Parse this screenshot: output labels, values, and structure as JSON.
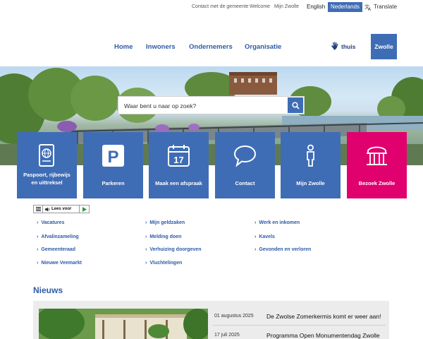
{
  "utility": {
    "contact": "Contact met de gemeente",
    "welcome": "Welcome",
    "mijn_zwolle": "Mijn Zwolle",
    "lang_english": "English",
    "lang_nederlands": "Nederlands",
    "translate": "Translate"
  },
  "nav": {
    "home": "Home",
    "inwoners": "Inwoners",
    "ondernemers": "Ondernemers",
    "organisatie": "Organisatie",
    "thuis": "thuis",
    "logo": "Zwolle"
  },
  "search": {
    "placeholder": "Waar bent u naar op zoek?"
  },
  "tiles": [
    {
      "line1": "Paspoort, rijbewijs",
      "line2": "en uittreksel",
      "icon": "passport-icon"
    },
    {
      "line1": "Parkeren",
      "icon": "parking-icon"
    },
    {
      "line1": "Maak een afspraak",
      "icon": "calendar-17-icon",
      "calendar_day": "17"
    },
    {
      "line1": "Contact",
      "icon": "speech-bubble-icon"
    },
    {
      "line1": "Mijn Zwolle",
      "icon": "person-icon"
    },
    {
      "line1": "Bezoek Zwolle",
      "icon": "building-icon"
    }
  ],
  "readaloud": {
    "label": "Lees voor"
  },
  "quicklinks": {
    "col1": [
      "Vacatures",
      "Afvalinzameling",
      "Gemeenteraad",
      "Nieuwe Veemarkt"
    ],
    "col2": [
      "Mijn geldzaken",
      "Melding doen",
      "Verhuizing doorgeven",
      "Vluchtelingen"
    ],
    "col3": [
      "Werk en inkomen",
      "Kavels",
      "Gevonden en verloren"
    ]
  },
  "news": {
    "title": "Nieuws",
    "items": [
      {
        "date": "01 augustus 2025",
        "headline": "De Zwolse Zomerkermis komt er weer aan!"
      },
      {
        "date": "17 juli 2025",
        "headline": "Programma Open Monumentendag Zwolle"
      }
    ]
  },
  "colors": {
    "brand_blue": "#3f6db5",
    "accent_pink": "#e0006e",
    "link_blue": "#2e5aa8"
  }
}
